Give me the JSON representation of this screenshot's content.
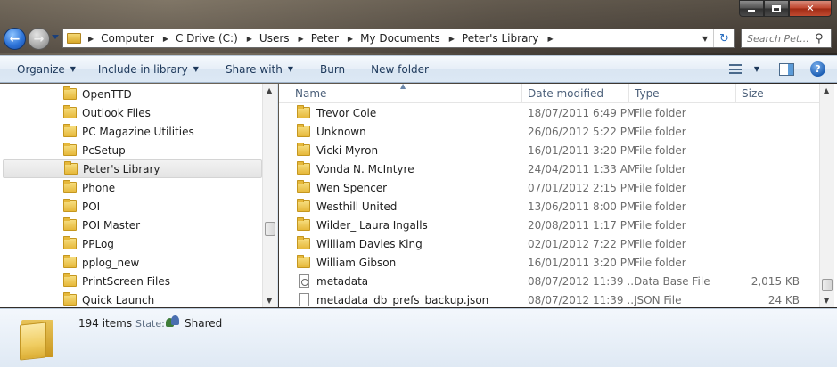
{
  "window": {
    "caption_buttons": {
      "minimize": "minimize",
      "maximize": "maximize",
      "close": "✕"
    }
  },
  "address": {
    "breadcrumbs": [
      "Computer",
      "C Drive (C:)",
      "Users",
      "Peter",
      "My Documents",
      "Peter's Library"
    ]
  },
  "search": {
    "placeholder": "Search Pet..."
  },
  "toolbar": {
    "organize": "Organize",
    "include_in_library": "Include in library",
    "share_with": "Share with",
    "burn": "Burn",
    "new_folder": "New folder"
  },
  "nav_tree": {
    "items": [
      {
        "label": "OpenTTD",
        "selected": false
      },
      {
        "label": "Outlook Files",
        "selected": false
      },
      {
        "label": "PC Magazine Utilities",
        "selected": false
      },
      {
        "label": "PcSetup",
        "selected": false
      },
      {
        "label": "Peter's Library",
        "selected": true
      },
      {
        "label": "Phone",
        "selected": false
      },
      {
        "label": "POI",
        "selected": false
      },
      {
        "label": "POI Master",
        "selected": false
      },
      {
        "label": "PPLog",
        "selected": false
      },
      {
        "label": "pplog_new",
        "selected": false
      },
      {
        "label": "PrintScreen Files",
        "selected": false
      },
      {
        "label": "Quick Launch",
        "selected": false
      }
    ]
  },
  "file_list": {
    "columns": {
      "name": "Name",
      "date_modified": "Date modified",
      "type": "Type",
      "size": "Size"
    },
    "rows": [
      {
        "name": "Trevor Cole",
        "date": "18/07/2011 6:49 PM",
        "type": "File folder",
        "size": "",
        "icon": "folder-icon"
      },
      {
        "name": "Unknown",
        "date": "26/06/2012 5:22 PM",
        "type": "File folder",
        "size": "",
        "icon": "folder-icon"
      },
      {
        "name": "Vicki Myron",
        "date": "16/01/2011 3:20 PM",
        "type": "File folder",
        "size": "",
        "icon": "folder-icon"
      },
      {
        "name": "Vonda N. McIntyre",
        "date": "24/04/2011 1:33 AM",
        "type": "File folder",
        "size": "",
        "icon": "folder-icon"
      },
      {
        "name": "Wen Spencer",
        "date": "07/01/2012 2:15 PM",
        "type": "File folder",
        "size": "",
        "icon": "folder-icon"
      },
      {
        "name": "Westhill United",
        "date": "13/06/2011 8:00 PM",
        "type": "File folder",
        "size": "",
        "icon": "folder-icon"
      },
      {
        "name": "Wilder_ Laura Ingalls",
        "date": "20/08/2011 1:17 PM",
        "type": "File folder",
        "size": "",
        "icon": "folder-icon"
      },
      {
        "name": "William Davies King",
        "date": "02/01/2012 7:22 PM",
        "type": "File folder",
        "size": "",
        "icon": "folder-icon"
      },
      {
        "name": "William Gibson",
        "date": "16/01/2011 3:20 PM",
        "type": "File folder",
        "size": "",
        "icon": "folder-icon"
      },
      {
        "name": "metadata",
        "date": "08/07/2012 11:39 ...",
        "type": "Data Base File",
        "size": "2,015 KB",
        "icon": "database-file-icon"
      },
      {
        "name": "metadata_db_prefs_backup.json",
        "date": "08/07/2012 11:39 ...",
        "type": "JSON File",
        "size": "24 KB",
        "icon": "file-icon"
      }
    ]
  },
  "details": {
    "item_count": "194 items",
    "state_label": "State:",
    "state_value": "Shared"
  }
}
